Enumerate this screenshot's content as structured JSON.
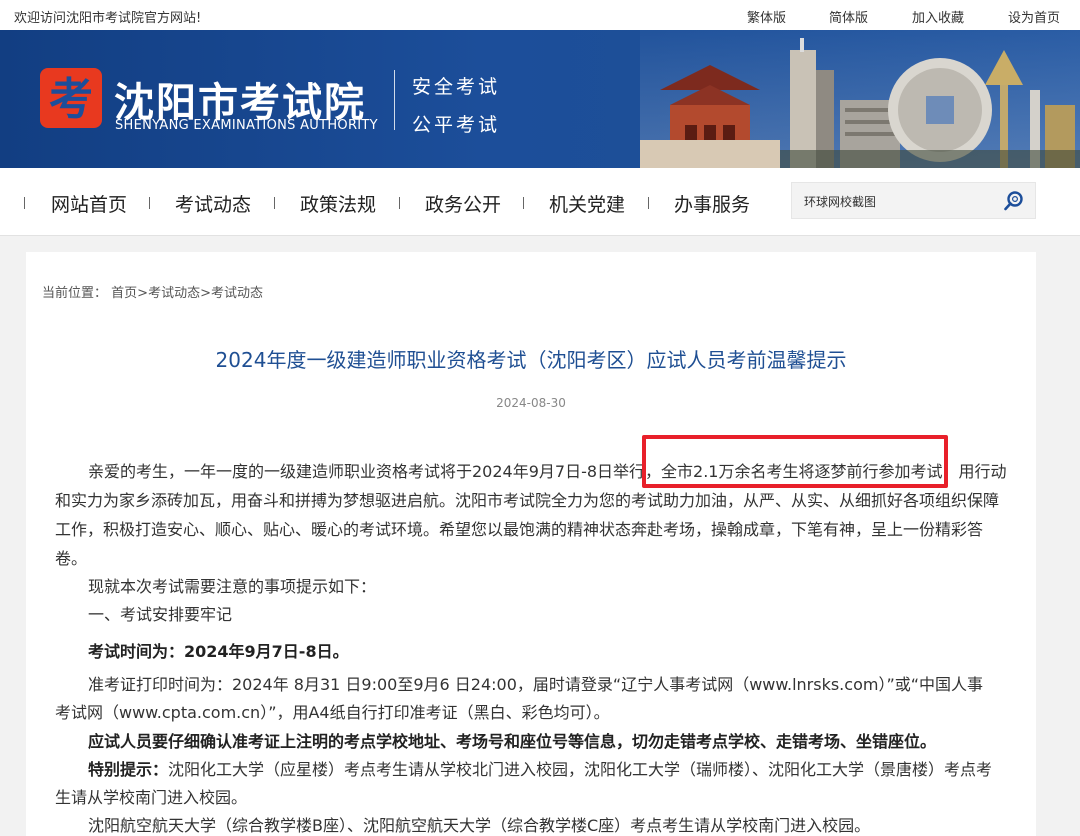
{
  "topbar": {
    "welcome": "欢迎访问沈阳市考试院官方网站!",
    "links": [
      "繁体版",
      "简体版",
      "加入收藏",
      "设为首页"
    ]
  },
  "header": {
    "logo_char": "考",
    "title": "沈阳市考试院",
    "subtitle": "SHENYANG EXAMINATIONS AUTHORITY",
    "slogan_1": "安全考试",
    "slogan_2": "公平考试",
    "colors": {
      "banner": "#1c4e9a",
      "logo_red": "#e8391f"
    }
  },
  "nav": {
    "items": [
      "网站首页",
      "考试动态",
      "政策法规",
      "政务公开",
      "机关党建",
      "办事服务"
    ],
    "search_value": "环球网校截图"
  },
  "breadcrumb": {
    "label": "当前位置：",
    "home": "首页",
    "level1": "考试动态",
    "level2": "考试动态",
    "separator": ">"
  },
  "article": {
    "title": "2024年度一级建造师职业资格考试（沈阳考区）应试人员考前温馨提示",
    "date": "2024-08-30",
    "lines": [
      "亲爱的考生，一年一度的一级建造师职业资格考试将于2024年9月7日-8日举行，全市2.1万余名考生将逐梦前行参加考试，用行动",
      "和实力为家乡添砖加瓦，用奋斗和拼搏为梦想驱进启航。沈阳市考试院全力为您的考试助力加油，从严、从实、从细抓好各项组织保障",
      "工作，积极打造安心、顺心、贴心、暖心的考试环境。希望您以最饱满的精神状态奔赴考场，操翰成章，下笔有神，呈上一份精彩答",
      "卷。",
      "现就本次考试需要注意的事项提示如下：",
      "一、考试安排要牢记",
      "考试时间为：2024年9月7日-8日。",
      "准考证打印时间为：2024年 8月31 日9:00至9月6 日24:00，届时请登录“辽宁人事考试网（www.lnrsks.com）”或“中国人事",
      "考试网（www.cpta.com.cn）”，用A4纸自行打印准考证（黑白、彩色均可）。",
      "应试人员要仔细确认准考证上注明的考点学校地址、考场号和座位号等信息，切勿走错考点学校、走错考场、坐错座位。",
      "特别提示：",
      "沈阳化工大学（应星楼）考点考生请从学校北门进入校园，沈阳化工大学（瑞师楼）、沈阳化工大学（景唐楼）考点考",
      "生请从学校南门进入校园。",
      "沈阳航空航天大学（综合教学楼B座）、沈阳航空航天大学（综合教学楼C座）考点考生请从学校南门进入校园。"
    ]
  }
}
